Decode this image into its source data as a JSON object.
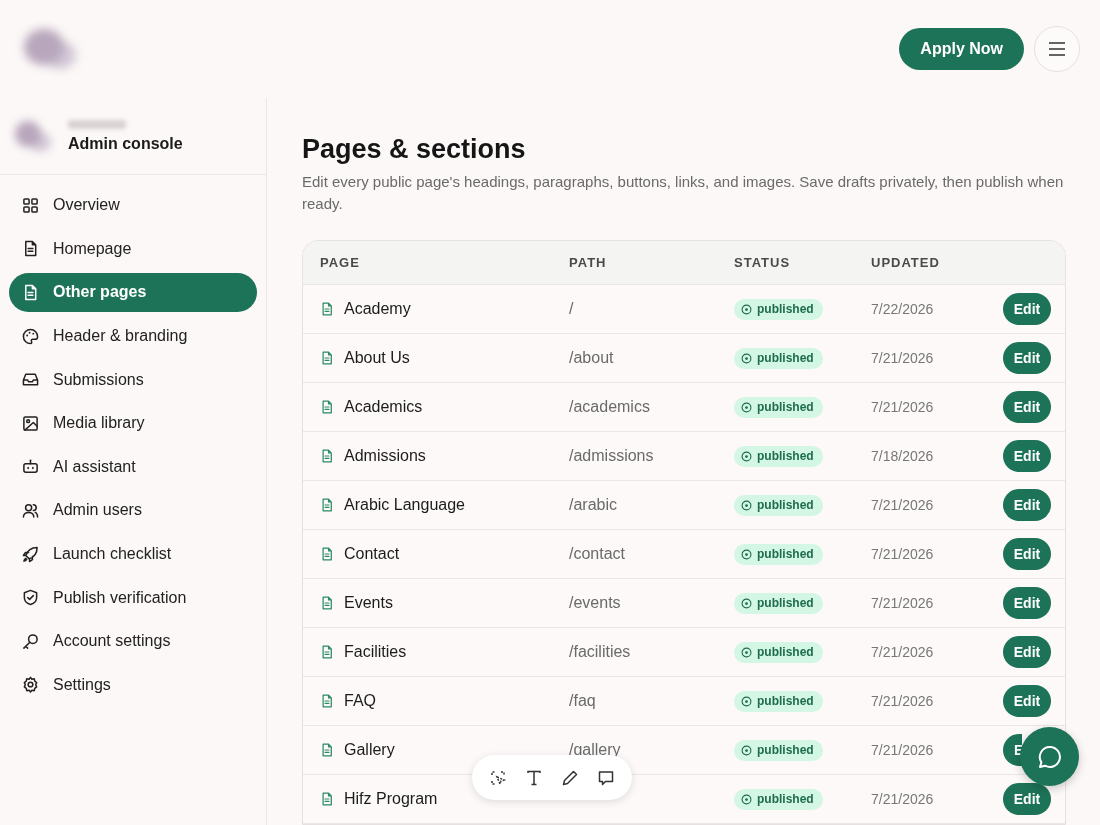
{
  "header": {
    "apply_button": "Apply Now"
  },
  "sidebar": {
    "subtitle": "Admin console",
    "items": [
      {
        "label": "Overview",
        "selected": false
      },
      {
        "label": "Homepage",
        "selected": false
      },
      {
        "label": "Other pages",
        "selected": true
      },
      {
        "label": "Header & branding",
        "selected": false
      },
      {
        "label": "Submissions",
        "selected": false
      },
      {
        "label": "Media library",
        "selected": false
      },
      {
        "label": "AI assistant",
        "selected": false
      },
      {
        "label": "Admin users",
        "selected": false
      },
      {
        "label": "Launch checklist",
        "selected": false
      },
      {
        "label": "Publish verification",
        "selected": false
      },
      {
        "label": "Account settings",
        "selected": false
      },
      {
        "label": "Settings",
        "selected": false
      }
    ]
  },
  "main": {
    "title": "Pages & sections",
    "description": "Edit every public page's headings, paragraphs, buttons, links, and images. Save drafts privately, then publish when ready.",
    "table": {
      "columns": [
        "PAGE",
        "PATH",
        "STATUS",
        "UPDATED"
      ],
      "rows": [
        {
          "page": "Academy",
          "path": "/",
          "status": "published",
          "updated": "7/22/2026",
          "action": "Edit"
        },
        {
          "page": "About Us",
          "path": "/about",
          "status": "published",
          "updated": "7/21/2026",
          "action": "Edit"
        },
        {
          "page": "Academics",
          "path": "/academics",
          "status": "published",
          "updated": "7/21/2026",
          "action": "Edit"
        },
        {
          "page": "Admissions",
          "path": "/admissions",
          "status": "published",
          "updated": "7/18/2026",
          "action": "Edit"
        },
        {
          "page": "Arabic Language",
          "path": "/arabic",
          "status": "published",
          "updated": "7/21/2026",
          "action": "Edit"
        },
        {
          "page": "Contact",
          "path": "/contact",
          "status": "published",
          "updated": "7/21/2026",
          "action": "Edit"
        },
        {
          "page": "Events",
          "path": "/events",
          "status": "published",
          "updated": "7/21/2026",
          "action": "Edit"
        },
        {
          "page": "Facilities",
          "path": "/facilities",
          "status": "published",
          "updated": "7/21/2026",
          "action": "Edit"
        },
        {
          "page": "FAQ",
          "path": "/faq",
          "status": "published",
          "updated": "7/21/2026",
          "action": "Edit"
        },
        {
          "page": "Gallery",
          "path": "/gallery",
          "status": "published",
          "updated": "7/21/2026",
          "action": "E"
        },
        {
          "page": "Hifz Program",
          "status": "published",
          "updated": "7/21/2026",
          "action": "Edit"
        }
      ]
    }
  }
}
